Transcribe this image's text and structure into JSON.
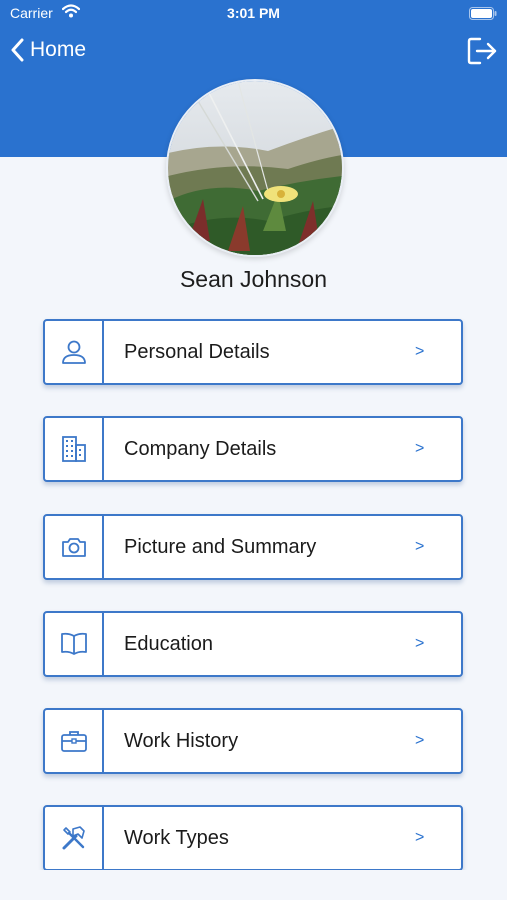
{
  "status_bar": {
    "carrier": "Carrier",
    "time": "3:01 PM"
  },
  "nav": {
    "back_label": "Home"
  },
  "profile": {
    "name": "Sean Johnson"
  },
  "menu": [
    {
      "label": "Personal Details",
      "icon": "person-icon",
      "chevron": ">"
    },
    {
      "label": "Company Details",
      "icon": "building-icon",
      "chevron": ">"
    },
    {
      "label": "Picture and Summary",
      "icon": "camera-icon",
      "chevron": ">"
    },
    {
      "label": "Education",
      "icon": "book-icon",
      "chevron": ">"
    },
    {
      "label": "Work History",
      "icon": "briefcase-icon",
      "chevron": ">"
    },
    {
      "label": "Work Types",
      "icon": "tools-icon",
      "chevron": ">"
    }
  ],
  "colors": {
    "header": "#2a72cf",
    "accent": "#3d78c9",
    "background": "#f3f6fb"
  }
}
